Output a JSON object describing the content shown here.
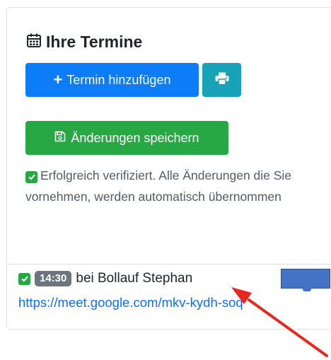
{
  "card": {
    "title": "Ihre Termine",
    "title_icon": "calendar-icon",
    "add_button_label": "Termin hinzufügen",
    "add_button_icon": "plus-icon",
    "print_button_icon": "printer-icon",
    "save_button_label": "Änderungen speichern",
    "save_button_icon": "save-icon",
    "verified_text": "Erfolgreich verifiziert. Alle Änderungen die Sie vornehmen, werden automatisch übernommen",
    "verified_icon": "checkbox-checked-icon"
  },
  "appointment": {
    "time": "14:30",
    "text": "bei Bollauf Stephan",
    "link": "https://meet.google.com/mkv-kydh-soq",
    "check_icon": "checkbox-checked-icon"
  },
  "colors": {
    "primary": "#0d7cf7",
    "info": "#18a2b8",
    "success": "#28a745",
    "badge": "#6c757d",
    "link": "#0d6efd",
    "annotation_arrow": "#e8281f",
    "annotation_rect": "#4472c4"
  }
}
